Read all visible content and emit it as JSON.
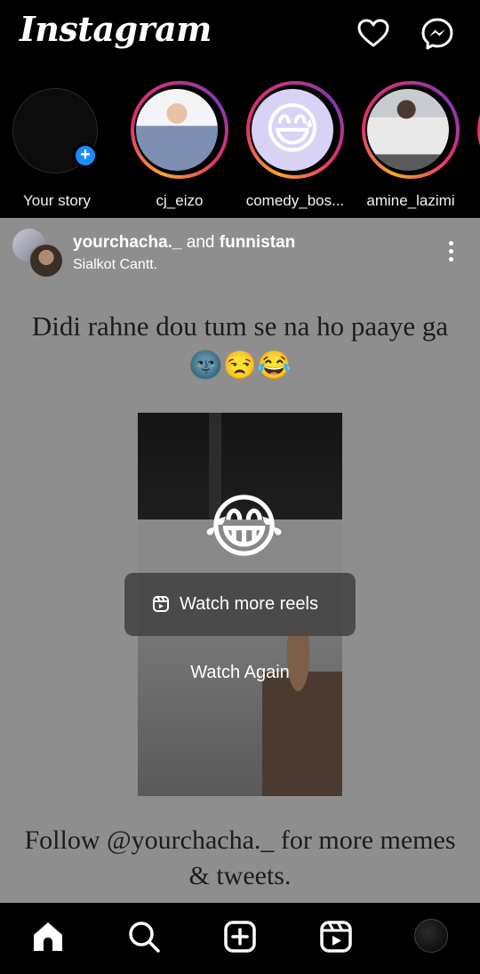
{
  "header": {
    "logo_text": "Instagram",
    "icons": [
      "heart-icon",
      "messenger-icon"
    ]
  },
  "stories": [
    {
      "label": "Your story",
      "own": true
    },
    {
      "label": "cj_eizo"
    },
    {
      "label": "comedy_bos..."
    },
    {
      "label": "amine_lazimi"
    }
  ],
  "post": {
    "author1": "yourchacha._",
    "joiner": "and",
    "author2": "funnistan",
    "location": "Sialkot Cantt.",
    "caption_top": "Didi rahne dou tum se na ho paaye ga 🌚😒😂",
    "caption_bottom": "Follow @yourchacha._ for more memes & tweets.",
    "overlay_emoji": "😂",
    "watch_more_reels": "Watch more reels",
    "watch_again": "Watch Again"
  },
  "nav": {
    "items": [
      "home-icon",
      "search-icon",
      "create-icon",
      "reels-icon",
      "profile-avatar"
    ]
  },
  "colors": {
    "background": "#000000",
    "post_dim": "#8e8e8e",
    "story_ring_start": "#f9a825",
    "story_ring_end": "#c13584",
    "plus_badge": "#1a8cff"
  }
}
